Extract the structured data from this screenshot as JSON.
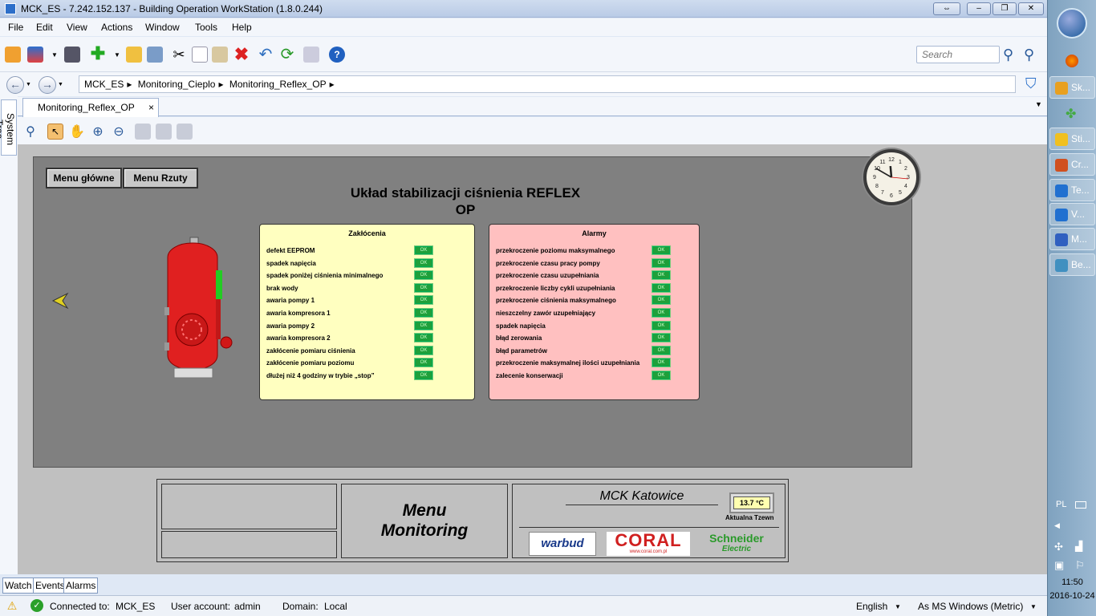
{
  "window": {
    "title": "MCK_ES - 7.242.152.137 - Building Operation WorkStation (1.8.0.244)"
  },
  "menu": [
    "File",
    "Edit",
    "View",
    "Actions",
    "Window",
    "Tools",
    "Help"
  ],
  "search": {
    "placeholder": "Search"
  },
  "breadcrumb": [
    "MCK_ES",
    "Monitoring_Cieplo",
    "Monitoring_Reflex_OP"
  ],
  "tab": {
    "label": "Monitoring_Reflex_OP",
    "close": "×"
  },
  "systree": {
    "label": "System Tree"
  },
  "graphic": {
    "buttons": {
      "main": "Menu główne",
      "plans": "Menu Rzuty"
    },
    "title_line1": "Układ stabilizacji ciśnienia REFLEX",
    "title_line2": "OP",
    "clock": {
      "hour": 11,
      "minute": 50
    },
    "zaklocenia": {
      "header": "Zakłócenia",
      "items": [
        "defekt EEPROM",
        "spadek napięcia",
        "spadek poniżej ciśnienia minimalnego",
        "brak wody",
        "awaria pompy 1",
        "awaria kompresora 1",
        "awaria pompy 2",
        "awaria kompresora 2",
        "zakłócenie pomiaru ciśnienia",
        "zakłócenie pomiaru poziomu",
        "dłużej niż 4 godziny w trybie „stop”"
      ]
    },
    "alarmy": {
      "header": "Alarmy",
      "items": [
        "przekroczenie poziomu maksymalnego",
        "przekroczenie czasu pracy pompy",
        "przekroczenie czasu uzupełniania",
        "przekroczenie liczby cykli uzupełniania",
        "przekroczenie ciśnienia maksymalnego",
        "nieszczelny zawór uzupełniający",
        "spadek napięcia",
        "błąd zerowania",
        "błąd parametrów",
        "przekroczenie maksymalnej ilości uzupełniania",
        "zalecenie konserwacji"
      ]
    },
    "indicator_text": "OK",
    "footer": {
      "menu_line1": "Menu",
      "menu_line2": "Monitoring",
      "site": "MCK Katowice",
      "temp": "13.7 °C",
      "temp_label": "Aktualna Tzewn",
      "logo1": "warbud",
      "logo2": "CORAL",
      "logo2_sub": "www.coral.com.pl",
      "logo3_line1": "Schneider",
      "logo3_line2": "Electric"
    }
  },
  "bottom_tabs": [
    "Watch",
    "Events",
    "Alarms"
  ],
  "status": {
    "connected_label": "Connected to:",
    "connected_value": "MCK_ES",
    "account_label": "User account:",
    "account_value": "admin",
    "domain_label": "Domain:",
    "domain_value": "Local",
    "language": "English",
    "units": "As MS Windows (Metric)"
  },
  "taskbar": {
    "items": [
      {
        "label": "Sk...",
        "color": "#e8a020"
      },
      {
        "label": "Sti...",
        "color": "#f0c020"
      },
      {
        "label": "Cr...",
        "color": "#d05020"
      },
      {
        "label": "Te...",
        "color": "#2070d0"
      },
      {
        "label": "V...",
        "color": "#2070d0"
      },
      {
        "label": "M...",
        "color": "#3060c0"
      },
      {
        "label": "Be...",
        "color": "#4090c0"
      }
    ],
    "lang": "PL",
    "time": "11:50",
    "date": "2016-10-24"
  }
}
